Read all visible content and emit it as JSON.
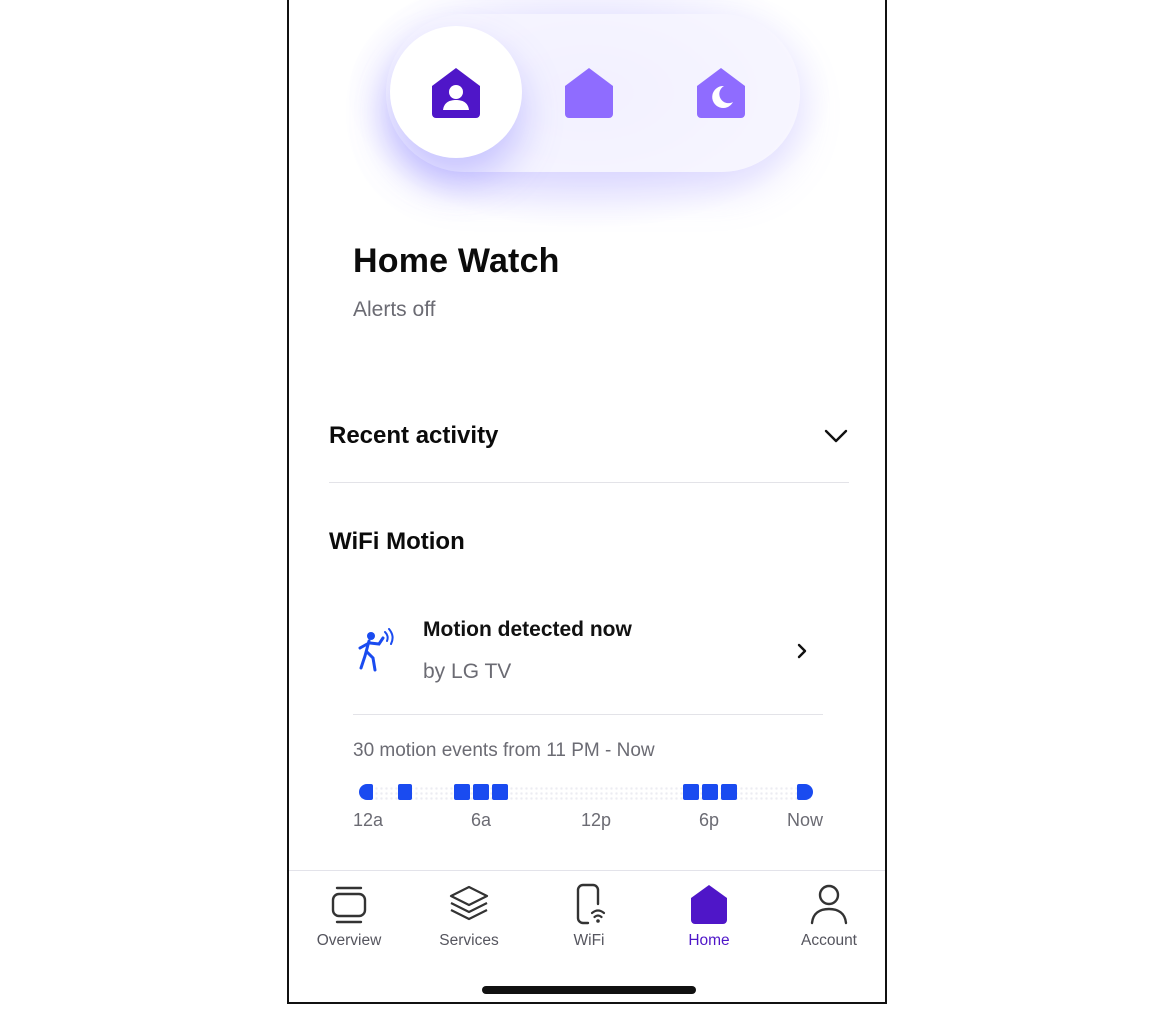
{
  "modes": [
    {
      "id": "home-watch",
      "icon": "home-person-icon",
      "active": true
    },
    {
      "id": "home",
      "icon": "home-icon",
      "active": false
    },
    {
      "id": "night",
      "icon": "home-moon-icon",
      "active": false
    }
  ],
  "header": {
    "title": "Home Watch",
    "subtitle": "Alerts off"
  },
  "recent_activity": {
    "label": "Recent activity",
    "icon": "chevron-down-icon"
  },
  "wifi_motion": {
    "title": "WiFi Motion",
    "event": {
      "icon": "person-motion-icon",
      "main": "Motion detected now",
      "sub": "by LG TV",
      "arrow_icon": "chevron-right-icon"
    },
    "summary": "30 motion events from 11 PM - Now",
    "timeline_labels": [
      "12a",
      "6a",
      "12p",
      "6p",
      "Now"
    ]
  },
  "nav": {
    "items": [
      {
        "label": "Overview",
        "icon": "overview-icon",
        "active": false
      },
      {
        "label": "Services",
        "icon": "layers-icon",
        "active": false
      },
      {
        "label": "WiFi",
        "icon": "phone-wifi-icon",
        "active": false
      },
      {
        "label": "Home",
        "icon": "home-icon",
        "active": true
      },
      {
        "label": "Account",
        "icon": "person-icon",
        "active": false
      }
    ]
  },
  "colors": {
    "accent": "#4f16c8",
    "mode_inactive": "#8f6cff",
    "motion_blue": "#1a4bf0"
  }
}
